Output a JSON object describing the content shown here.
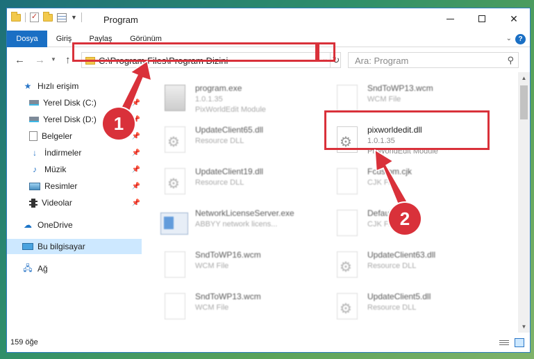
{
  "window": {
    "title": "Program"
  },
  "ribbon": {
    "tabs": [
      "Dosya",
      "Giriş",
      "Paylaş",
      "Görünüm"
    ]
  },
  "nav": {
    "address": "C:\\Program Files\\Program Dizini",
    "search_placeholder": "Ara: Program"
  },
  "sidebar": {
    "items": [
      {
        "label": "Hızlı erişim",
        "icon": "star-icon"
      },
      {
        "label": "Yerel Disk (C:)",
        "icon": "drive-icon"
      },
      {
        "label": "Yerel Disk (D:)",
        "icon": "drive-icon"
      },
      {
        "label": "Belgeler",
        "icon": "documents-icon"
      },
      {
        "label": "İndirmeler",
        "icon": "downloads-icon"
      },
      {
        "label": "Müzik",
        "icon": "music-icon"
      },
      {
        "label": "Resimler",
        "icon": "pictures-icon"
      },
      {
        "label": "Videolar",
        "icon": "videos-icon"
      },
      {
        "label": "OneDrive",
        "icon": "cloud-icon"
      },
      {
        "label": "Bu bilgisayar",
        "icon": "computer-icon"
      },
      {
        "label": "Ağ",
        "icon": "network-icon"
      }
    ]
  },
  "files": [
    {
      "name": "program.exe",
      "line1": "1.0.1.35",
      "line2": "PixWorldEdit Module"
    },
    {
      "name": "SndToWP13.wcm",
      "line1": "WCM File",
      "line2": ""
    },
    {
      "name": "UpdateClient65.dll",
      "line1": "Resource DLL",
      "line2": ""
    },
    {
      "name": "pixworldedit.dll",
      "line1": "1.0.1.35",
      "line2": "PixWorldEdit Module"
    },
    {
      "name": "UpdateClient19.dll",
      "line1": "Resource DLL",
      "line2": ""
    },
    {
      "name": "Fcustom.cjk",
      "line1": "CJK File",
      "line2": ""
    },
    {
      "name": "NetworkLicenseServer.exe",
      "line1": "ABBYY network licens...",
      "line2": ""
    },
    {
      "name": "Default.cjk",
      "line1": "CJK File",
      "line2": ""
    },
    {
      "name": "SndToWP16.wcm",
      "line1": "WCM File",
      "line2": ""
    },
    {
      "name": "UpdateClient63.dll",
      "line1": "Resource DLL",
      "line2": ""
    },
    {
      "name": "SndToWP13.wcm",
      "line1": "WCM File",
      "line2": ""
    },
    {
      "name": "UpdateClient5.dll",
      "line1": "Resource DLL",
      "line2": ""
    }
  ],
  "status": {
    "count": "159 öğe"
  },
  "annotations": {
    "badge1": "1",
    "badge2": "2",
    "color": "#d9313a"
  }
}
